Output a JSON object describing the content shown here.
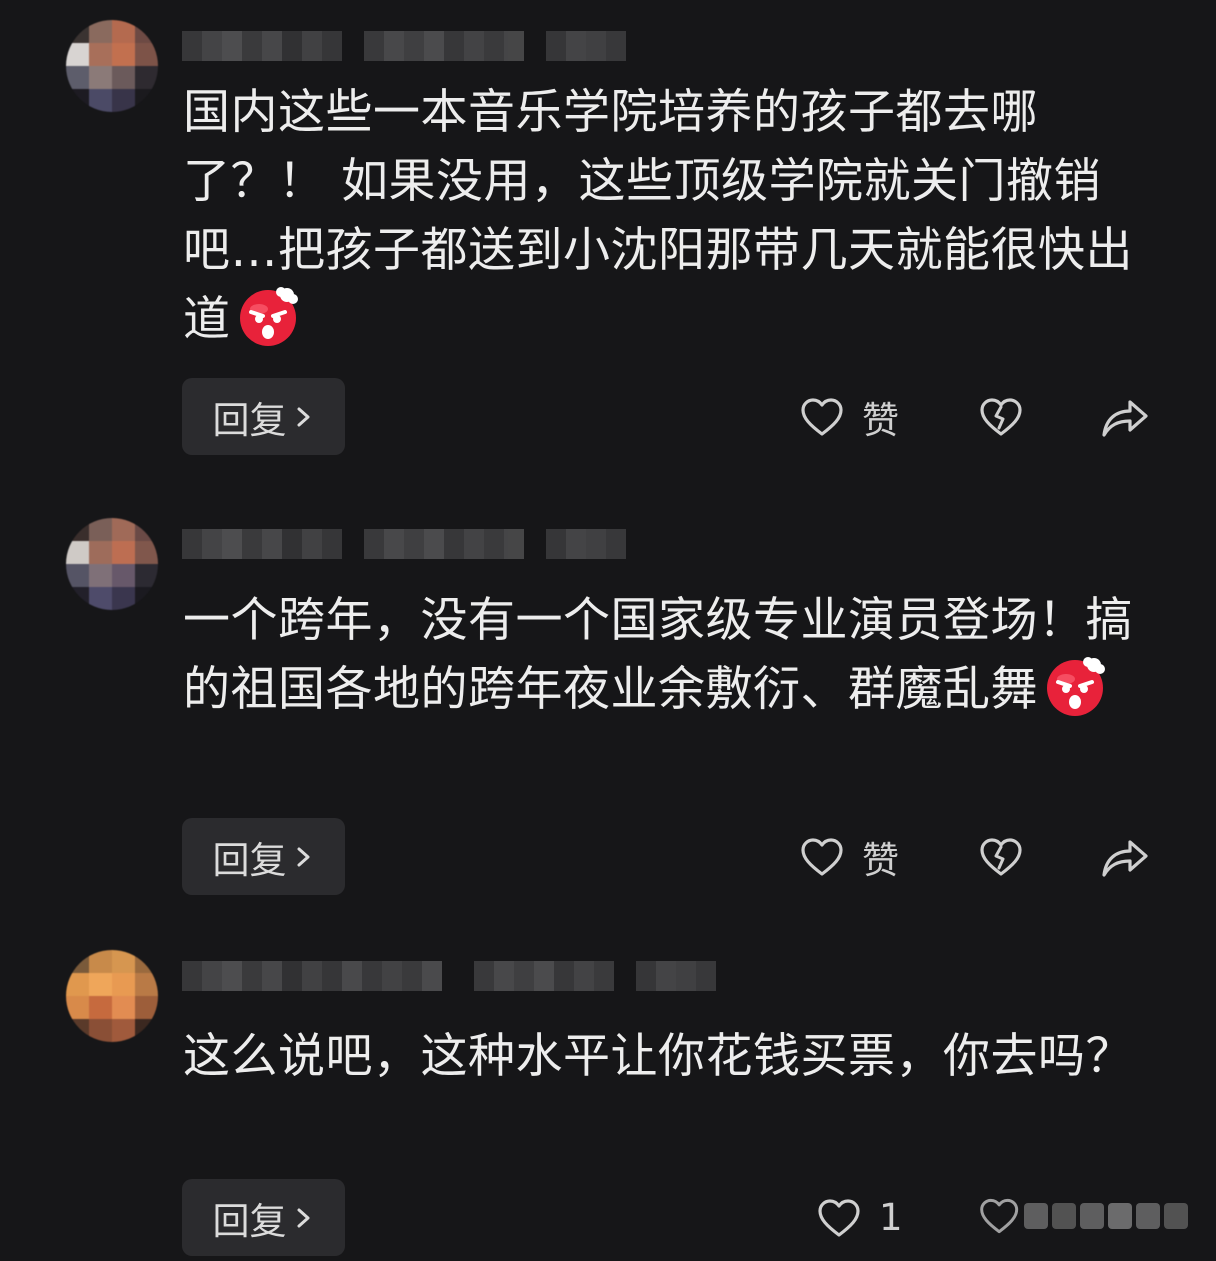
{
  "colors": {
    "background": "#161618",
    "text": "#ededed",
    "button_bg": "#2b2b2e",
    "icon": "#cfcfcf",
    "emoji_red": "#e8223a"
  },
  "comments": [
    {
      "text": "国内这些一本音乐学院培养的孩子都去哪了？！ 如果没用，这些顶级学院就关门撤销吧…把孩子都送到小沈阳那带几天就能很快出道",
      "emoji": "angry-face-emoji",
      "reply_label": "回复",
      "like_label": "赞",
      "icons": [
        "heart-outline-icon",
        "broken-heart-icon",
        "share-arrow-icon"
      ]
    },
    {
      "text": "一个跨年，没有一个国家级专业演员登场！搞的祖国各地的跨年夜业余敷衍、群魔乱舞",
      "emoji": "angry-face-emoji",
      "reply_label": "回复",
      "like_label": "赞",
      "icons": [
        "heart-outline-icon",
        "broken-heart-icon",
        "share-arrow-icon"
      ]
    },
    {
      "text": "这么说吧，这种水平让你花钱买票，你去吗？",
      "reply_label": "回复",
      "like_label": "1",
      "icons": [
        "heart-outline-icon",
        "broken-heart-icon",
        "share-arrow-icon"
      ]
    }
  ]
}
